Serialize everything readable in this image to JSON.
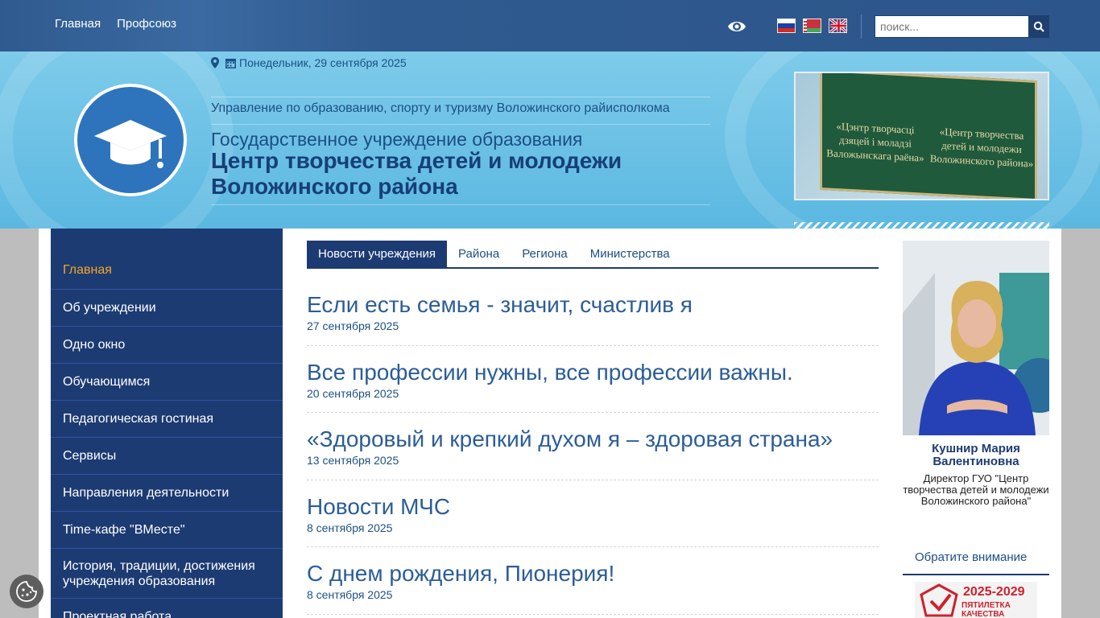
{
  "topbar": {
    "menu": [
      "Главная",
      "Профсоюз"
    ],
    "search_placeholder": "поиск..."
  },
  "header": {
    "date": "Понедельник, 29 сентября 2025",
    "org": "Управление по образованию, спорту и туризму Воложинского райисполкома",
    "inst_line1": "Государственное учреждение образования",
    "inst_line2": "Центр творчества детей и молодежи",
    "inst_line3": "Воложинского района",
    "plaque_left": "«Цэнтр творчасці дзяцей і моладзі Валожынскага раёна»",
    "plaque_right": "«Центр творчества детей и молодежи Воложинского района»"
  },
  "sidebar": {
    "items": [
      "Главная",
      "Об учреждении",
      "Одно окно",
      "Обучающимся",
      "Педагогическая гостиная",
      "Сервисы",
      "Направления деятельности",
      "Time-кафе \"ВМесте\"",
      "История, традиции, достижения учреждения образования",
      "Проектная работа"
    ]
  },
  "tabs": [
    "Новости учреждения",
    "Района",
    "Региона",
    "Министерства"
  ],
  "news": [
    {
      "title": "Если есть семья - значит, счастлив я",
      "date": "27 сентября 2025"
    },
    {
      "title": "Все профессии нужны, все профессии важны.",
      "date": "20 сентября 2025"
    },
    {
      "title": "«Здоровый и крепкий духом я – здоровая страна»",
      "date": "13 сентября 2025"
    },
    {
      "title": "Новости МЧС",
      "date": "8 сентября 2025"
    },
    {
      "title": "С днем рождения, Пионерия!",
      "date": "8 сентября 2025"
    }
  ],
  "director": {
    "name": "Кушнир Мария Валентиновна",
    "position": "Директор ГУО \"Центр творчества детей и молодежи Воложинского района\""
  },
  "attention": {
    "title": "Обратите внимание",
    "banner_years": "2025-2029",
    "banner_text": "ПЯТИЛЕТКА КАЧЕСТВА"
  },
  "colors": {
    "primary": "#1d3b73",
    "accent": "#f5a623",
    "link": "#2b5d98"
  }
}
